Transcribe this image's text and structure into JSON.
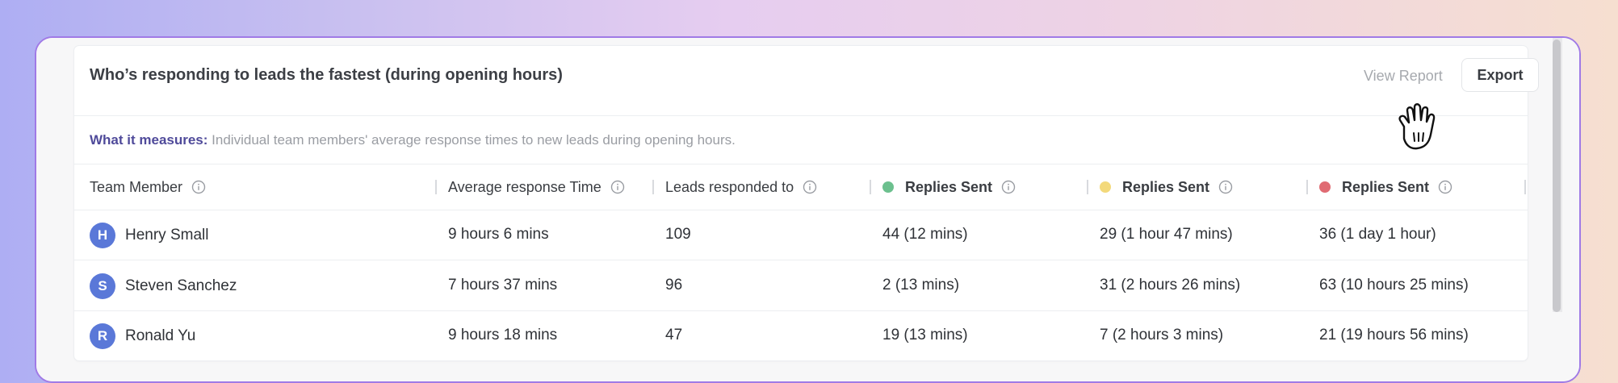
{
  "card": {
    "title": "Who’s responding to leads the fastest (during opening hours)",
    "view_report": "View Report",
    "export": "Export"
  },
  "measure": {
    "label": "What it measures:",
    "text": "Individual team members' average response times to new leads during opening hours."
  },
  "columns": [
    {
      "label": "Team Member"
    },
    {
      "label": "Average response Time"
    },
    {
      "label": "Leads responded to"
    },
    {
      "label": "Replies Sent",
      "dot_color": "#6cc08e"
    },
    {
      "label": "Replies Sent",
      "dot_color": "#f3d97b"
    },
    {
      "label": "Replies Sent",
      "dot_color": "#e06b73"
    }
  ],
  "rows": [
    {
      "initial": "H",
      "name": "Henry Small",
      "avg": "9 hours 6 mins",
      "leads": "109",
      "green": "44 (12 mins)",
      "yellow": "29 (1 hour 47 mins)",
      "red": "36 (1 day 1 hour)"
    },
    {
      "initial": "S",
      "name": "Steven Sanchez",
      "avg": "7 hours 37 mins",
      "leads": "96",
      "green": "2 (13 mins)",
      "yellow": "31 (2 hours 26 mins)",
      "red": "63 (10 hours 25 mins)"
    },
    {
      "initial": "R",
      "name": "Ronald Yu",
      "avg": "9 hours 18 mins",
      "leads": "47",
      "green": "19 (13 mins)",
      "yellow": "7 (2 hours 3 mins)",
      "red": "21 (19 hours 56 mins)"
    }
  ],
  "colors": {
    "avatar": "#5a78d8",
    "accent_border": "#a07ae6",
    "measure_label": "#4f4a9a"
  }
}
